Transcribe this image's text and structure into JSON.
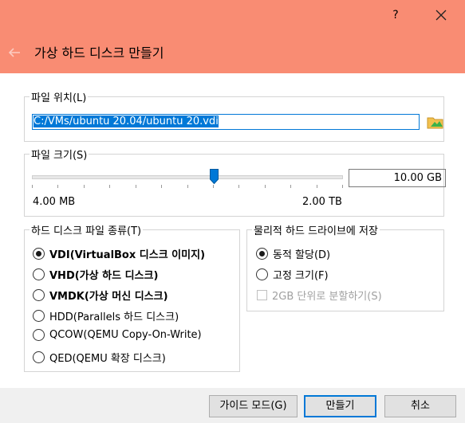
{
  "dialog": {
    "title": "가상 하드 디스크 만들기",
    "help_label": "?"
  },
  "file_location": {
    "legend": "파일 위치(L)",
    "path_value": "C:/VMs/ubuntu 20.04/ubuntu 20.vdi"
  },
  "file_size": {
    "legend": "파일 크기(S)",
    "value": "10.00 GB",
    "min_label": "4.00 MB",
    "max_label": "2.00 TB",
    "slider_position_fraction": 0.585
  },
  "disk_type": {
    "legend": "하드 디스크 파일 종류(T)",
    "options": [
      {
        "label": "VDI(VirtualBox 디스크 이미지)",
        "checked": true,
        "bold": true
      },
      {
        "label": "VHD(가상 하드 디스크)",
        "checked": false,
        "bold": true
      },
      {
        "label": "VMDK(가상 머신 디스크)",
        "checked": false,
        "bold": true
      },
      {
        "label": "HDD(Parallels 하드 디스크)",
        "checked": false,
        "bold": false
      },
      {
        "label": "QCOW(QEMU Copy-On-Write)",
        "checked": false,
        "bold": false
      },
      {
        "label": "QED(QEMU 확장 디스크)",
        "checked": false,
        "bold": false
      }
    ]
  },
  "storage": {
    "legend": "물리적 하드 드라이브에 저장",
    "dynamic_label": "동적 할당(D)",
    "fixed_label": "고정 크기(F)",
    "split_label": "2GB 단위로 분할하기(S)",
    "dynamic_checked": true,
    "split_enabled": false
  },
  "buttons": {
    "guided_mode": "가이드 모드(G)",
    "create": "만들기",
    "cancel": "취소"
  },
  "colors": {
    "header_bg": "#f98c73",
    "accent": "#0078d7"
  }
}
